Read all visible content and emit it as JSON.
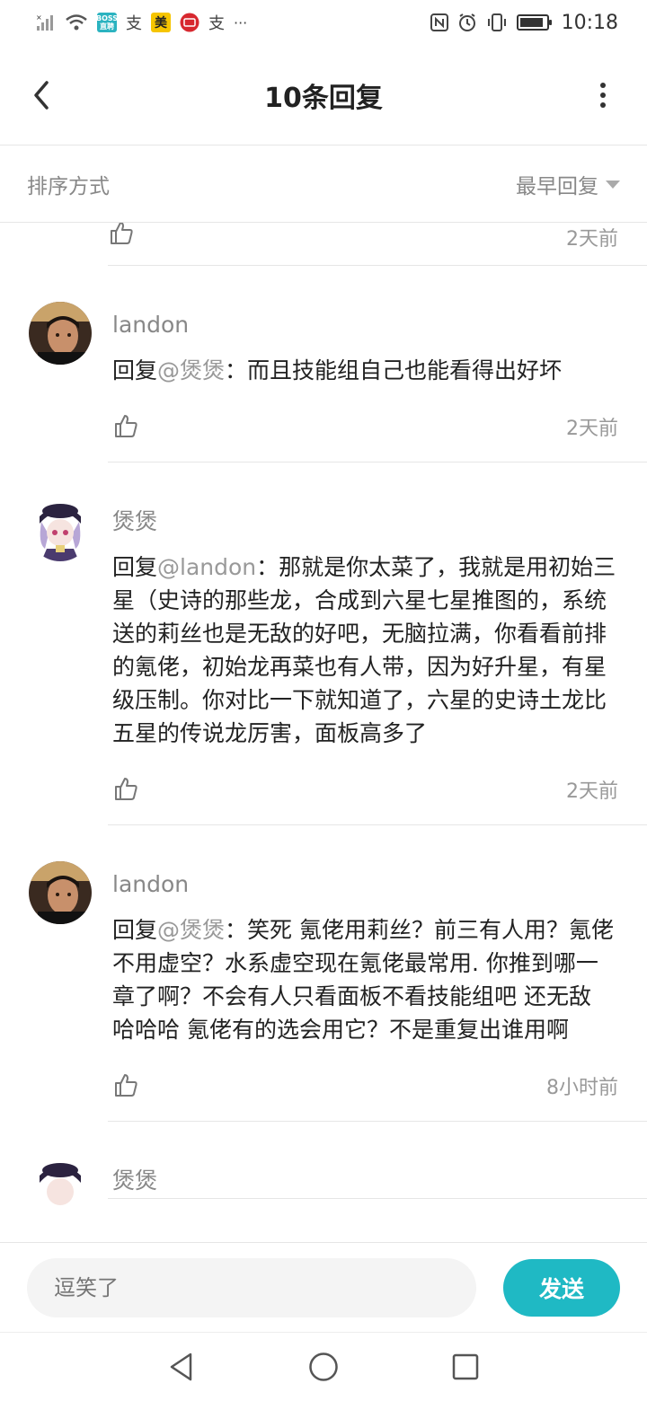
{
  "status_bar": {
    "time": "10:18",
    "battery_level": 0.9,
    "left_icons": [
      "signal-icon",
      "wifi-icon",
      "boss-app-icon",
      "alipay-icon",
      "meituan-icon",
      "unionpay-icon",
      "alipay-icon",
      "more-icon"
    ],
    "boss_label": "BOSS\n直聘",
    "meituan_label": "美",
    "alipay_label": "支",
    "more_label": "···"
  },
  "header": {
    "title": "10条回复"
  },
  "sort": {
    "label": "排序方式",
    "selected": "最早回复"
  },
  "comments": [
    {
      "partial": true,
      "time": "2天前"
    },
    {
      "username": "landon",
      "prefix": "回复",
      "mention": "@煲煲",
      "text": "：而且技能组自己也能看得出好坏",
      "time": "2天前",
      "avatar": "landon"
    },
    {
      "username": "煲煲",
      "prefix": "回复",
      "mention": "@landon",
      "text": "：那就是你太菜了，我就是用初始三星（史诗的那些龙，合成到六星七星推图的，系统送的莉丝也是无敌的好吧，无脑拉满，你看看前排的氪佬，初始龙再菜也有人带，因为好升星，有星级压制。你对比一下就知道了，六星的史诗土龙比五星的传说龙厉害，面板高多了",
      "time": "2天前",
      "avatar": "baobao"
    },
    {
      "username": "landon",
      "prefix": "回复",
      "mention": "@煲煲",
      "text": "：笑死 氪佬用莉丝？前三有人用？氪佬不用虚空？水系虚空现在氪佬最常用. 你推到哪一章了啊？不会有人只看面板不看技能组吧 还无敌 哈哈哈 氪佬有的选会用它？不是重复出谁用啊",
      "time": "8小时前",
      "avatar": "landon"
    },
    {
      "username": "煲煲",
      "partial_bottom": true,
      "avatar": "baobao"
    }
  ],
  "input": {
    "placeholder": "逗笑了",
    "send_label": "发送"
  },
  "colors": {
    "accent": "#1fb9c4",
    "muted_text": "#888888",
    "divider": "#e6e6e6"
  }
}
